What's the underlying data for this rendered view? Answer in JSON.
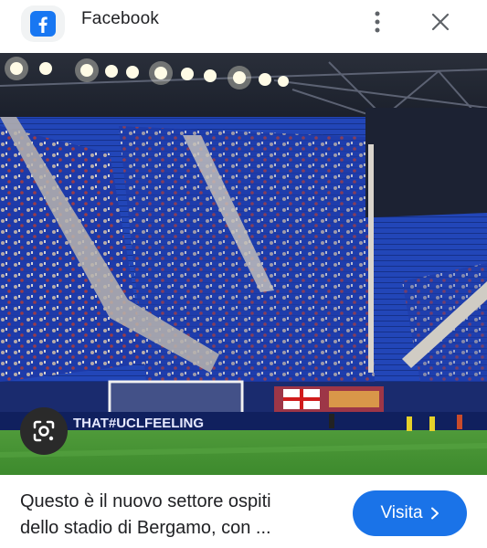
{
  "header": {
    "app_icon": "facebook-icon",
    "title": "Facebook",
    "more_icon": "more-vertical-icon",
    "close_icon": "close-icon"
  },
  "media": {
    "banner_text": "THAT#UCLFEELING",
    "lens_icon": "image-search-icon"
  },
  "caption": {
    "line1": "Questo è il nuovo settore ospiti",
    "line2": "dello stadio di Bergamo, con ..."
  },
  "visit_button": {
    "label": "Visita",
    "icon": "chevron-right-icon",
    "color": "#1a73e8"
  }
}
